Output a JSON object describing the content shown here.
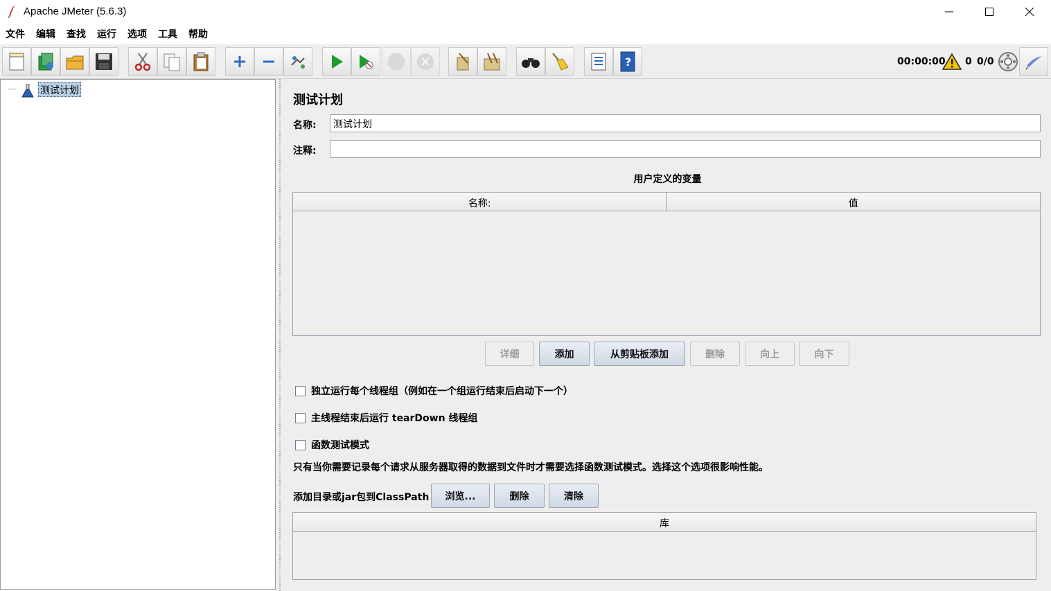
{
  "window": {
    "title": "Apache JMeter (5.6.3)",
    "controls": [
      "minimize-icon",
      "maximize-icon",
      "close-icon"
    ]
  },
  "menu": [
    "文件",
    "编辑",
    "查找",
    "运行",
    "选项",
    "工具",
    "帮助"
  ],
  "toolbar": {
    "buttons": [
      {
        "name": "new",
        "icon": "new-file-icon",
        "enabled": true
      },
      {
        "name": "templates",
        "icon": "templates-icon",
        "enabled": true
      },
      {
        "name": "open",
        "icon": "open-folder-icon",
        "enabled": true
      },
      {
        "name": "save",
        "icon": "save-icon",
        "enabled": true
      },
      {
        "name": "cut",
        "icon": "cut-icon",
        "enabled": true
      },
      {
        "name": "copy",
        "icon": "copy-icon",
        "enabled": true
      },
      {
        "name": "paste",
        "icon": "paste-icon",
        "enabled": true
      },
      {
        "name": "expand",
        "icon": "plus-icon",
        "enabled": true
      },
      {
        "name": "collapse",
        "icon": "minus-icon",
        "enabled": true
      },
      {
        "name": "toggle",
        "icon": "toggle-icon",
        "enabled": true
      },
      {
        "name": "start",
        "icon": "play-icon",
        "enabled": true
      },
      {
        "name": "start-no-pauses",
        "icon": "play-no-timers-icon",
        "enabled": true
      },
      {
        "name": "stop",
        "icon": "stop-icon",
        "enabled": false
      },
      {
        "name": "shutdown",
        "icon": "shutdown-icon",
        "enabled": false
      },
      {
        "name": "clear",
        "icon": "clear-icon",
        "enabled": true
      },
      {
        "name": "clear-all",
        "icon": "clear-all-icon",
        "enabled": true
      },
      {
        "name": "search",
        "icon": "binoculars-icon",
        "enabled": true
      },
      {
        "name": "reset-search",
        "icon": "broom-icon",
        "enabled": true
      },
      {
        "name": "function-helper",
        "icon": "list-icon",
        "enabled": true
      },
      {
        "name": "help",
        "icon": "help-book-icon",
        "enabled": true
      }
    ],
    "timer": "00:00:00",
    "warnings": "0",
    "threads": "0/0"
  },
  "tree": {
    "root_label": "测试计划"
  },
  "panel": {
    "heading": "测试计划",
    "name_label": "名称:",
    "name_value": "测试计划",
    "comment_label": "注释:",
    "comment_value": "",
    "vars_caption": "用户定义的变量",
    "vars_columns": [
      "名称:",
      "值"
    ],
    "vars_buttons": [
      {
        "label": "详细",
        "enabled": false
      },
      {
        "label": "添加",
        "enabled": true
      },
      {
        "label": "从剪贴板添加",
        "enabled": true
      },
      {
        "label": "删除",
        "enabled": false
      },
      {
        "label": "向上",
        "enabled": false
      },
      {
        "label": "向下",
        "enabled": false
      }
    ],
    "checkboxes": [
      {
        "label": "独立运行每个线程组（例如在一个组运行结束后启动下一个）",
        "checked": false
      },
      {
        "label": "主线程结束后运行 tearDown 线程组",
        "checked": false
      },
      {
        "label": "函数测试模式",
        "checked": false
      }
    ],
    "note": "只有当你需要记录每个请求从服务器取得的数据到文件时才需要选择函数测试模式。选择这个选项很影响性能。",
    "classpath_label": "添加目录或jar包到ClassPath",
    "classpath_buttons": [
      "浏览...",
      "删除",
      "清除"
    ],
    "lib_column": "库"
  }
}
